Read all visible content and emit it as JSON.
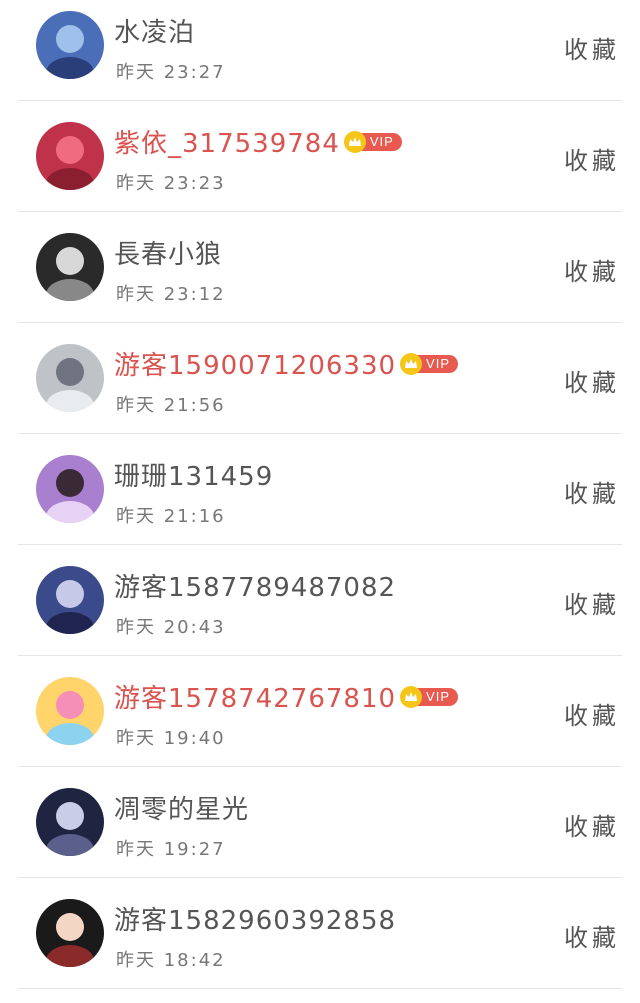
{
  "rows": [
    {
      "name": "水凌泊",
      "time": "昨天 23:27",
      "action": "收藏",
      "vip": false,
      "avatar_colors": [
        "#4a6fb8",
        "#9fc0ea",
        "#2a3f7a"
      ]
    },
    {
      "name": "紫依_317539784",
      "time": "昨天 23:23",
      "action": "收藏",
      "vip": true,
      "vip_label": "VIP",
      "avatar_colors": [
        "#c0314a",
        "#f06b80",
        "#8a1f30"
      ]
    },
    {
      "name": "長春小狼",
      "time": "昨天 23:12",
      "action": "收藏",
      "vip": false,
      "avatar_colors": [
        "#2a2a2a",
        "#d8d8d8",
        "#888888"
      ]
    },
    {
      "name": "游客1590071206330",
      "time": "昨天 21:56",
      "action": "收藏",
      "vip": true,
      "vip_label": "VIP",
      "avatar_colors": [
        "#bfc3c8",
        "#6f7480",
        "#e9ecef"
      ]
    },
    {
      "name": "珊珊131459",
      "time": "昨天 21:16",
      "action": "收藏",
      "vip": false,
      "avatar_colors": [
        "#a97fd0",
        "#3a2a36",
        "#e7d2f5"
      ]
    },
    {
      "name": "游客1587789487082",
      "time": "昨天 20:43",
      "action": "收藏",
      "vip": false,
      "avatar_colors": [
        "#3b4a8a",
        "#c7c9e8",
        "#1f2550"
      ]
    },
    {
      "name": "游客1578742767810",
      "time": "昨天 19:40",
      "action": "收藏",
      "vip": true,
      "vip_label": "VIP",
      "avatar_colors": [
        "#ffd46a",
        "#f58fb8",
        "#8cd3f0"
      ]
    },
    {
      "name": "凋零的星光",
      "time": "昨天 19:27",
      "action": "收藏",
      "vip": false,
      "avatar_colors": [
        "#1f2440",
        "#c9cde8",
        "#5a5f8c"
      ]
    },
    {
      "name": "游客1582960392858",
      "time": "昨天 18:42",
      "action": "收藏",
      "vip": false,
      "avatar_colors": [
        "#1a1a1a",
        "#f3d6c4",
        "#8a2a2a"
      ]
    }
  ],
  "colors": {
    "vip_name": "#d9534f",
    "vip_tag": "#e85a50",
    "crown": "#f5c518"
  }
}
